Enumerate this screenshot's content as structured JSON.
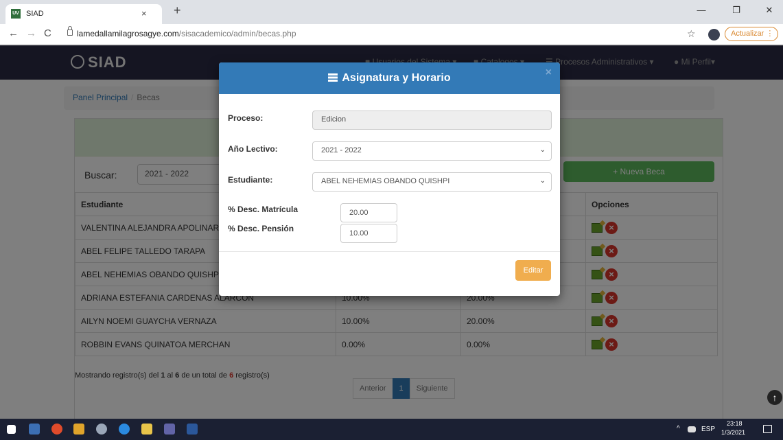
{
  "browser": {
    "tab_title": "SIAD",
    "tab_favicon": "UV",
    "tab_close": "×",
    "new_tab": "+",
    "url_host": "lamedallamilagrosagye.com",
    "url_path": "/sisacademico/admin/becas.php",
    "update_label": "Actualizar",
    "update_glyph": "⋮",
    "nav": {
      "back": "←",
      "forward": "→",
      "reload": "C"
    },
    "window": {
      "minimize": "—",
      "restore": "❐",
      "close": "✕"
    },
    "star": "☆"
  },
  "app": {
    "brand": "SIAD",
    "menu": [
      {
        "icon": "lock-icon",
        "label": "Usuarios del Sistema"
      },
      {
        "icon": "file-icon",
        "label": "Catalogos"
      },
      {
        "icon": "list-icon",
        "label": "Procesos Administrativos"
      },
      {
        "icon": "user-icon",
        "label": "Mi Perfil"
      }
    ]
  },
  "breadcrumb": {
    "home": "Panel Principal",
    "separator": "/",
    "current": "Becas"
  },
  "search": {
    "label": "Buscar:",
    "value": "2021 - 2022"
  },
  "new_button": "+ Nueva Beca",
  "table": {
    "headers": [
      "Estudiante",
      "",
      "",
      "Opciones"
    ],
    "rows": [
      {
        "student": "VALENTINA ALEJANDRA APOLINARIO",
        "d1": "",
        "d2": ""
      },
      {
        "student": "ABEL FELIPE TALLEDO TARAPA",
        "d1": "",
        "d2": ""
      },
      {
        "student": "ABEL NEHEMIAS OBANDO QUISHPI",
        "d1": "",
        "d2": ""
      },
      {
        "student": "ADRIANA ESTEFANIA CARDENAS ALARCON",
        "d1": "10.00%",
        "d2": "20.00%"
      },
      {
        "student": "AILYN NOEMI GUAYCHA VERNAZA",
        "d1": "10.00%",
        "d2": "20.00%"
      },
      {
        "student": "ROBBIN EVANS QUINATOA MERCHAN",
        "d1": "0.00%",
        "d2": "0.00%"
      }
    ]
  },
  "summary": {
    "prefix": "Mostrando registro(s) del",
    "from": "1",
    "mid1": "al",
    "to": "6",
    "mid2": "de un total de",
    "total": "6",
    "suffix": "registro(s)"
  },
  "pager": {
    "prev": "Anterior",
    "current": "1",
    "next": "Siguiente"
  },
  "scroll_top": "↑",
  "modal": {
    "title": "Asignatura y Horario",
    "close": "×",
    "proceso": {
      "label": "Proceso:",
      "value": "Edicion"
    },
    "anio": {
      "label": "Año Lectivo:",
      "value": "2021 - 2022"
    },
    "estudiante": {
      "label": "Estudiante:",
      "value": "ABEL NEHEMIAS OBANDO QUISHPI"
    },
    "matricula": {
      "label": "% Desc. Matrícula",
      "value": "20.00"
    },
    "pension": {
      "label": "% Desc. Pensión",
      "value": "10.00"
    },
    "submit": "Editar",
    "caret": "⌄"
  },
  "taskbar": {
    "lang": "ESP",
    "time": "23:18",
    "date": "1/3/2021",
    "tray_arrow": "^"
  }
}
